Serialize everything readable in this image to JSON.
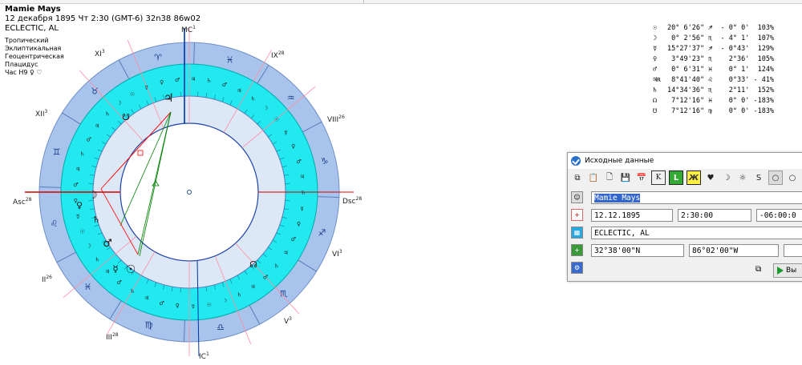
{
  "header": {
    "name": "Mamie Mays",
    "datetime": "12 декабря 1895  Чт   2:30 (GMT-6) 32n38  86w02",
    "place": "ECLECTIC, AL"
  },
  "chart_meta": {
    "zodiac": "Тропический",
    "coordinates": "Эклиптикальная",
    "centricity": "Геоцентрическая",
    "houses": "Плацидус",
    "hour": "Час H9 ♀ ♡"
  },
  "chart_labels": {
    "mc": "MC",
    "mc_deg": "1",
    "ic": "IC",
    "ic_deg": "1",
    "asc": "Asc",
    "asc_deg": "28",
    "dsc": "Dsc",
    "dsc_deg": "28",
    "houses": [
      {
        "label": "XI",
        "deg": "3"
      },
      {
        "label": "IX",
        "deg": "28"
      },
      {
        "label": "XII",
        "deg": "3"
      },
      {
        "label": "VIII",
        "deg": "26"
      },
      {
        "label": "II",
        "deg": "26"
      },
      {
        "label": "VI",
        "deg": "3"
      },
      {
        "label": "III",
        "deg": "28"
      },
      {
        "label": "V",
        "deg": "3"
      }
    ],
    "zodiac_glyphs": [
      "♌",
      "♓",
      "♍",
      "♎",
      "♏",
      "♐",
      "♑",
      "♒",
      "♓",
      "♈",
      "♉",
      "♊"
    ]
  },
  "positions": [
    {
      "glyph": "☉",
      "text": "20° 6'26\" ♐  - 0° 0'  103%"
    },
    {
      "glyph": "☽",
      "text": " 0° 2'56\" ♏  - 4° 1'  107%"
    },
    {
      "glyph": "☿",
      "text": "15°27'37\" ♐  - 0°43'  129%"
    },
    {
      "glyph": "♀",
      "text": " 3°49'23\" ♏    2°36'  105%"
    },
    {
      "glyph": "♂",
      "text": " 0° 6'31\" ♓    0° 1'  124%"
    },
    {
      "glyph": "♃ʀ",
      "text": " 8°41'40\" ♌    0°33' - 41%"
    },
    {
      "glyph": "♄",
      "text": "14°34'36\" ♏    2°11'  152%"
    },
    {
      "glyph": "☊",
      "text": " 7°12'16\" ♓    0° 0' -183%"
    },
    {
      "glyph": "☋",
      "text": " 7°12'16\" ♍    0° 0' -183%"
    }
  ],
  "dialog": {
    "title": "Исходные данные",
    "name_value": "Mamie Mays",
    "date_value": "12.12.1895",
    "time_value": "2:30:00",
    "tz_value": "-06:00:0",
    "place_value": "ECLECTIC, AL",
    "lat_value": "32°38'00\"N",
    "lon_value": "86°02'00\"W",
    "run_label": "Вы",
    "tb_k": "K",
    "tb_l": "L",
    "tb_h": "Ж"
  },
  "colors": {
    "outer_ring": "#a8c4ec",
    "house_ring": "#22e8f0",
    "inner_ring": "#dce8f6",
    "house_line": "#ff8ca0",
    "axis_line": "#d00000",
    "mc_line": "#0033aa"
  }
}
